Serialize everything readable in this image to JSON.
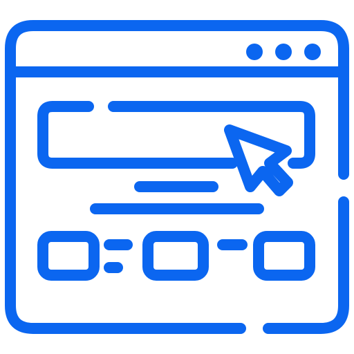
{
  "icon": {
    "name": "web-page-click-icon",
    "stroke_color": "#0b66f0",
    "background_color": "#ffffff",
    "window_controls": {
      "dot_count": 3
    }
  }
}
